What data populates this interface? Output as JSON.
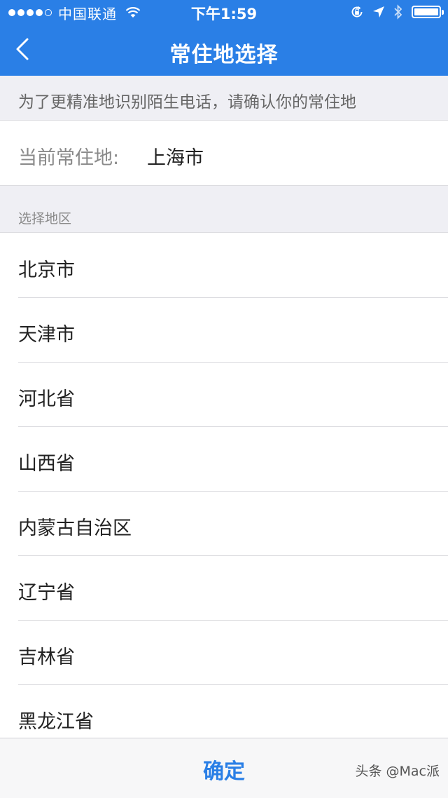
{
  "status_bar": {
    "carrier": "中国联通",
    "time": "下午1:59",
    "signal_bars_filled": 4,
    "signal_bars_total": 5
  },
  "nav": {
    "title": "常住地选择",
    "back_icon": "chevron-left-icon"
  },
  "info": {
    "text": "为了更精准地识别陌生电话，请确认你的常住地"
  },
  "current": {
    "label": "当前常住地:",
    "value": "上海市"
  },
  "section": {
    "title": "选择地区"
  },
  "regions": [
    {
      "label": "北京市"
    },
    {
      "label": "天津市"
    },
    {
      "label": "河北省"
    },
    {
      "label": "山西省"
    },
    {
      "label": "内蒙古自治区"
    },
    {
      "label": "辽宁省"
    },
    {
      "label": "吉林省"
    },
    {
      "label": "黑龙江省"
    }
  ],
  "bottom": {
    "confirm_label": "确定",
    "watermark": "头条 @Mac派"
  },
  "colors": {
    "accent": "#2a7fe6",
    "section_bg": "#efeff4"
  }
}
